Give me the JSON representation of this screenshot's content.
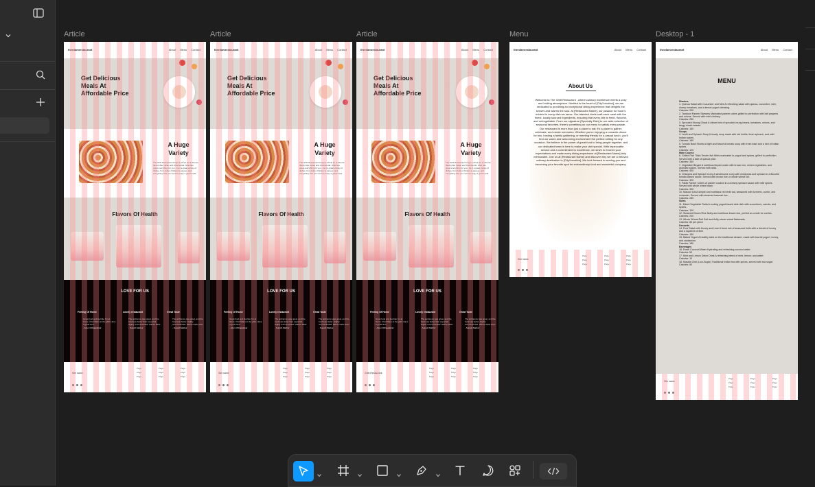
{
  "colors": {
    "canvas": "#1e1e1e",
    "panel": "#2c2c2c",
    "accent": "#0d99ff",
    "grid_overlay": "#ff8282",
    "hero_bg": "#dedad5",
    "dark_section": "#0c0404"
  },
  "left_panel": {
    "icons": [
      "sidebar-toggle-icon",
      "chevron-down-icon",
      "search-icon",
      "plus-icon"
    ]
  },
  "frames": [
    {
      "label": "Article",
      "kind": "article"
    },
    {
      "label": "Article",
      "kind": "article"
    },
    {
      "label": "Article",
      "kind": "article"
    },
    {
      "label": "Menu",
      "kind": "about"
    },
    {
      "label": "Desktop - 1",
      "kind": "menu"
    }
  ],
  "site": {
    "brand": "therdamrestaurant",
    "nav": [
      "About",
      "Menu",
      "Contact"
    ],
    "hero_title": "Get Delicious Meals At Affordable Price",
    "variety_title": "A Huge Variety",
    "variety_text": "The Ghitt Restaurant brings a whole lot of diverse flavors like Indian and Continental. Ghitt has great everything for you - be it a great variety of dishes, from butter chicken to paneer, and everything else you need to enjoy a good meal.",
    "flavors_title": "Flavors Of Health",
    "love_title": "LOVE FOR US",
    "testimonials": [
      {
        "heading": "Feeling Of Home",
        "quote": "Great food and feel like I'm at home. Chef Manu at the ghitt. Have a good time. ",
        "author": "- Arjun Chhajadekar"
      },
      {
        "heading": "Lovely restaurant",
        "quote": "The ambience was great, and the food was better than expected. Highly recommended. Will be back.",
        "author": "- Suresh Mathur"
      },
      {
        "heading": "Great Taste",
        "quote": "The ambience was great, and the food was better. Highly recommended. Will be back soon.",
        "author": "- Suresh Mathur"
      }
    ],
    "footer_site": "Site name",
    "footer_site_alt": "Ghitt Restaurant",
    "footer_links": [
      "Page",
      "Page",
      "Page"
    ]
  },
  "about": {
    "title": "About Us",
    "text": "Welcome to The Ghitt Restaurant , where culinary excellence meets a cozy and inviting atmosphere. Nestled in the heart of [City/Location], we are dedicated to providing an exceptional dining experience that delights the senses and warms the soul. At [Restaurant Name], our passion for food is evident in every dish we serve. Our talented chefs craft each meal with the finest, locally sourced ingredients, ensuring that every bite is fresh, flavorful, and unforgettable. From our signature [Specialty Dish] to our wide selection of seasonal favorites, there's something on our menu to satisfy every palate. Our restaurant is more than just a place to eat; it's a place to gather, celebrate, and create memories. Whether you're enjoying a romantic dinner for two, hosting a family gathering, or meeting friends for a casual lunch, you'll find our warm and welcoming environment the perfect setting for any occasion. We believe in the power of great food to bring people together, and our dedicated team is here to make your visit special. With impeccable service and a commitment to excellence, we strive to exceed your expectations and make every dining experience at [Restaurant Name] truly memorable. Join us at [Restaurant Name] and discover why we are a beloved culinary destination in [City/Location]. We look forward to serving you and becoming your favorite spot for extraordinary food and wonderful company."
  },
  "menu": {
    "title": "MENU",
    "lines": [
      {
        "t": "Starters",
        "h": true
      },
      {
        "t": "1. Quinoa Salad with Cucumber and Mint A refreshing salad with quinoa, cucumber, mint, cherry tomatoes, and a lemon yogurt dressing."
      },
      {
        "t": "Calories: 200"
      },
      {
        "t": "2. Tandoori Paneer Skewers Marinated paneer cubes grilled to perfection with bell peppers and onions. Served with mint chutney."
      },
      {
        "t": "Calories: 250"
      },
      {
        "t": "3. Sprouted Moong Chaat A vibrant mix of sprouted mung beans, tomatoes, onions, and tangy chaat masala."
      },
      {
        "t": "Calories: 150"
      },
      {
        "t": "Soups",
        "h": true
      },
      {
        "t": "4. Lentil and Spinach Soup A hearty soup made with red lentils, fresh spinach, and mild Indian spices."
      },
      {
        "t": "Calories: 180"
      },
      {
        "t": "5. Tomato Basil Shorba A light and flavorful tomato soup with fresh basil and a hint of Indian spices."
      },
      {
        "t": "Calories: 120"
      },
      {
        "t": "Main Course",
        "h": true
      },
      {
        "t": "6. Grilled Fish Tikka Tender fish fillets marinated in yogurt and spices, grilled to perfection. Served with a side of quinoa pilaf."
      },
      {
        "t": "Calories: 350"
      },
      {
        "t": "7. Vegetable Biryani A nutritious biryani made with brown rice, mixed vegetables, and aromatic spices. Served with raita."
      },
      {
        "t": "Calories: 400"
      },
      {
        "t": "8. Chickpea and Spinach Curry A wholesome curry with chickpeas and spinach in a flavorful tomato-based sauce. Served with brown rice or whole wheat roti."
      },
      {
        "t": "Calories: 320"
      },
      {
        "t": "9. Palak Paneer Cubes of paneer cooked in a creamy spinach sauce with mild spices. Served with whole wheat naan."
      },
      {
        "t": "Calories: 300"
      },
      {
        "t": "10. Masoor Dal A simple and nutritious red lentil dal, seasoned with turmeric, cumin, and coriander. Served with steamed basmati rice."
      },
      {
        "t": "Calories: 280"
      },
      {
        "t": "Sides",
        "h": true
      },
      {
        "t": "11. Mixed Vegetable Raita A cooling yogurt-based side dish with cucumbers, carrots, and spices."
      },
      {
        "t": "Calories: 100"
      },
      {
        "t": "12. Steamed Brown Rice Nutty and nutritious brown rice, perfect as a side for curries."
      },
      {
        "t": "Calories: 200"
      },
      {
        "t": "13. Whole Wheat Roti Soft and fluffy whole wheat flatbreads."
      },
      {
        "t": "Calories: 80 per piece"
      },
      {
        "t": "Desserts",
        "h": true
      },
      {
        "t": "14. Fruit Salad with Honey and Lime A fresh mix of seasonal fruits with a drizzle of honey and a squeeze of lime."
      },
      {
        "t": "Calories: 150"
      },
      {
        "t": "15. Baked Yogurt A healthy twist on the traditional dessert, made with low-fat yogurt, honey, and cardamom."
      },
      {
        "t": "Calories: 180"
      },
      {
        "t": "Beverages",
        "h": true
      },
      {
        "t": "16. Fresh Coconut Water Hydrating and refreshing coconut water."
      },
      {
        "t": "Calories: 50"
      },
      {
        "t": "17. Mint and Lemon Detox Drink A refreshing blend of mint, lemon, and water."
      },
      {
        "t": "Calories: 10"
      },
      {
        "t": "18. Masala Chai (Low-Sugar) Traditional Indian tea with spices, served with low sugar."
      },
      {
        "t": "Calories: 60"
      }
    ]
  },
  "toolbar": {
    "tools": [
      "move-tool",
      "frame-tool",
      "rectangle-tool",
      "pen-tool",
      "text-tool",
      "comment-tool",
      "actions-tool",
      "dev-mode-toggle"
    ]
  }
}
